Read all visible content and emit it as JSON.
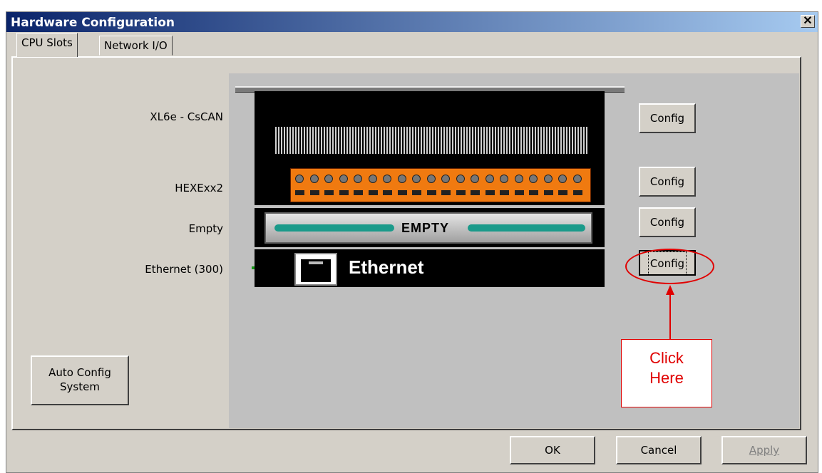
{
  "window": {
    "title": "Hardware Configuration",
    "close_glyph": "✕"
  },
  "tabs": [
    {
      "label": "CPU Slots",
      "active": true
    },
    {
      "label": "Network I/O",
      "active": false
    }
  ],
  "slots": [
    {
      "label": "XL6e - CsCAN",
      "button": "Config"
    },
    {
      "label": "HEXExx2",
      "button": "Config"
    },
    {
      "label": "Empty",
      "button": "Config",
      "plate_text": "EMPTY"
    },
    {
      "label": "Ethernet (300)",
      "button": "Config",
      "module_text": "Ethernet"
    }
  ],
  "auto_config": {
    "line1": "Auto Config",
    "line2": "System"
  },
  "annotation": {
    "line1": "Click",
    "line2": "Here",
    "color": "#e00000"
  },
  "footer": {
    "ok": "OK",
    "cancel": "Cancel",
    "apply": "Apply"
  },
  "colors": {
    "titlebar_start": "#0a246a",
    "titlebar_end": "#a6caf0",
    "module_orange": "#f07a10",
    "empty_bar": "#1a9a8a"
  },
  "icons": [
    "close-icon",
    "ethernet-jack-icon",
    "arrow-up-icon"
  ]
}
